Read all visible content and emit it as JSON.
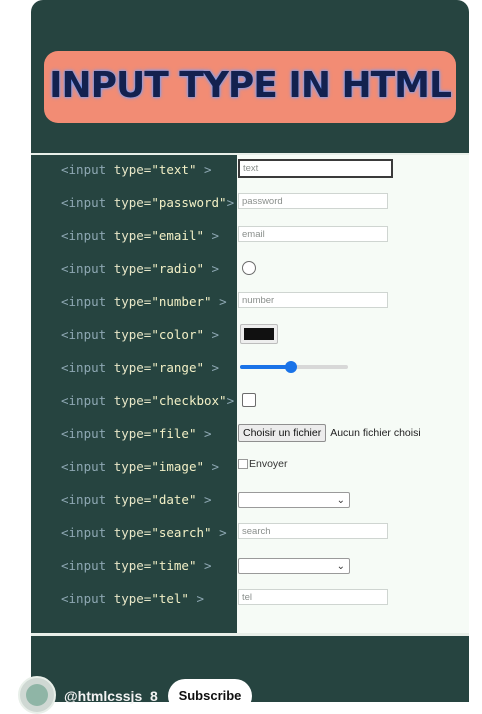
{
  "banner": {
    "title": "INPUT TYPE IN HTML"
  },
  "rows": [
    {
      "type": "text",
      "widget": "textbox",
      "placeholder": "text"
    },
    {
      "type": "password",
      "widget": "textbox",
      "placeholder": "password"
    },
    {
      "type": "email",
      "widget": "textbox",
      "placeholder": "email"
    },
    {
      "type": "radio",
      "widget": "radio"
    },
    {
      "type": "number",
      "widget": "textbox",
      "placeholder": "number"
    },
    {
      "type": "color",
      "widget": "color",
      "value": "#111111"
    },
    {
      "type": "range",
      "widget": "range",
      "fraction": 0.47
    },
    {
      "type": "checkbox",
      "widget": "checkbox"
    },
    {
      "type": "file",
      "widget": "file",
      "button_label": "Choisir un fichier",
      "status": "Aucun fichier choisi"
    },
    {
      "type": "image",
      "widget": "image",
      "alt": "Envoyer"
    },
    {
      "type": "date",
      "widget": "select"
    },
    {
      "type": "search",
      "widget": "textbox",
      "placeholder": "search"
    },
    {
      "type": "time",
      "widget": "select"
    },
    {
      "type": "tel",
      "widget": "textbox",
      "placeholder": "tel"
    }
  ],
  "code_tokens": {
    "open": "<input",
    "attr": "type=",
    "close": ">"
  },
  "footer": {
    "channel": "@htmlcssjs_8",
    "subscribe_label": "Subscribe"
  },
  "colors": {
    "card_bg": "#264440",
    "banner_bg": "#f28c74",
    "title_color": "#13214f",
    "accent": "#1a73e8"
  }
}
